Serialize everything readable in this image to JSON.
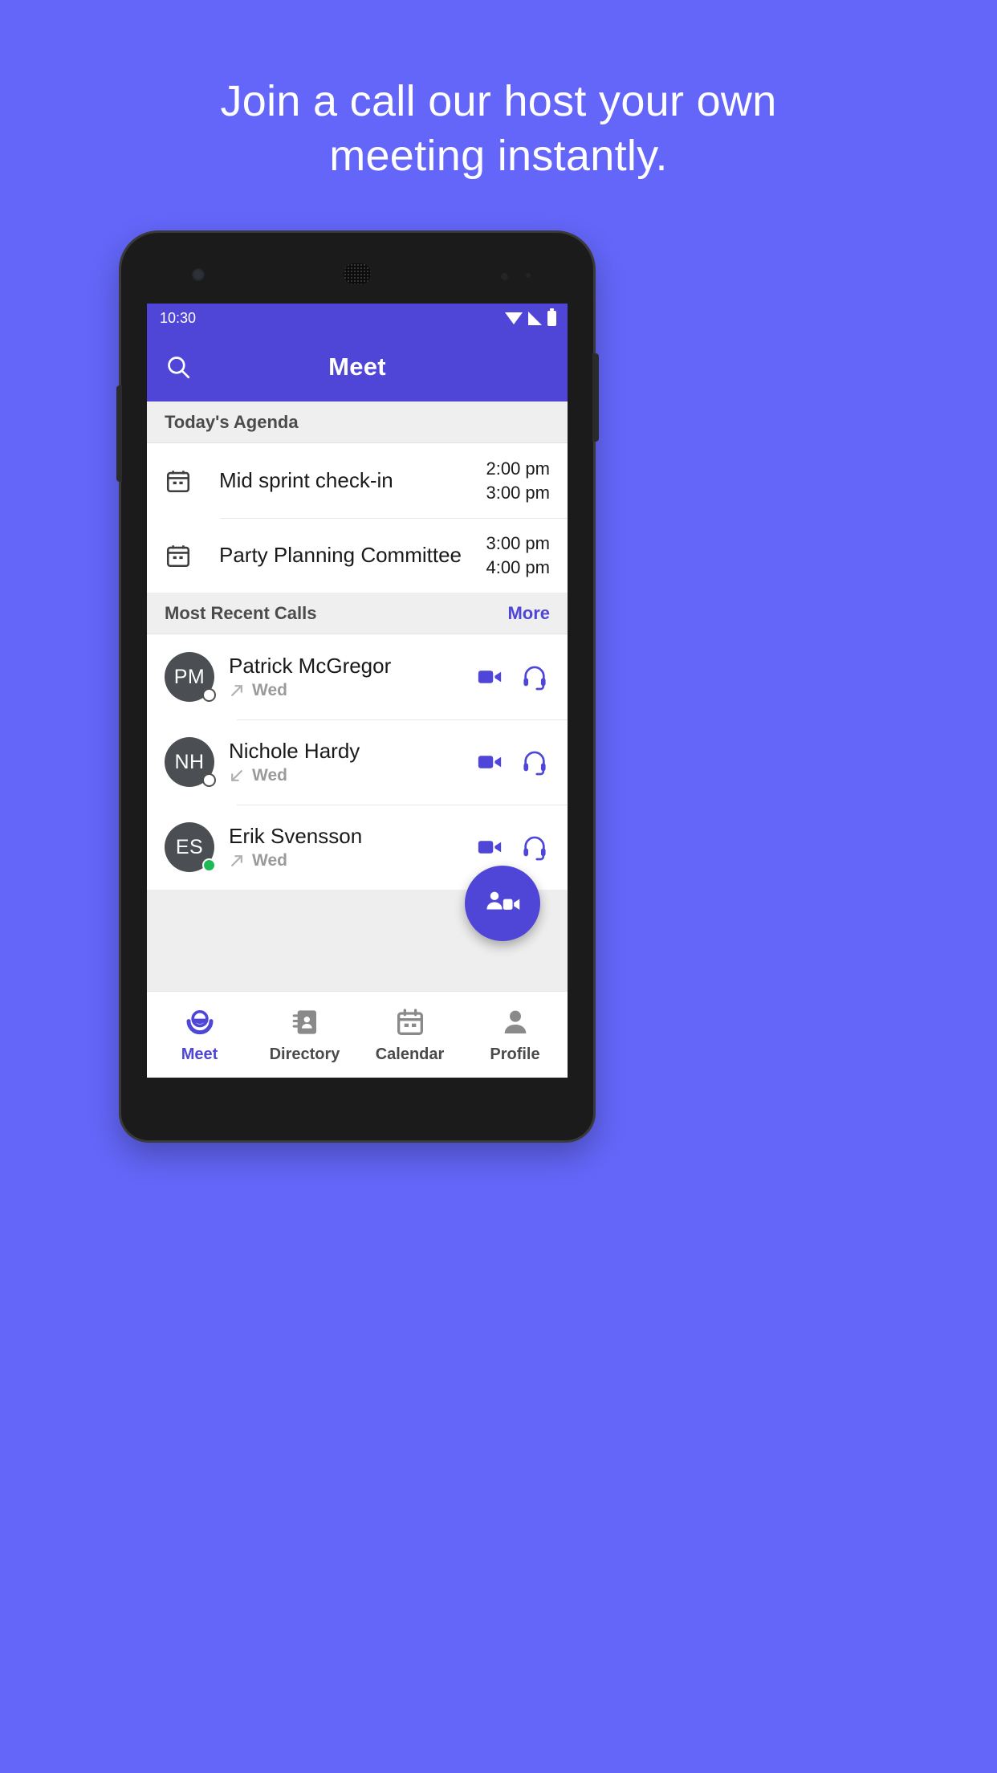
{
  "marketing": {
    "line1": "Join a call our host your own",
    "line2": "meeting instantly."
  },
  "colors": {
    "brand_purple": "#4f46d8",
    "page_background": "#6366f8",
    "avatar_grey": "#4b4f54",
    "online_green": "#1db954"
  },
  "statusbar": {
    "time": "10:30",
    "icons": [
      "wifi-icon",
      "signal-icon",
      "battery-icon"
    ]
  },
  "appbar": {
    "title": "Meet",
    "search_icon": "search-icon"
  },
  "agenda": {
    "section_title": "Today's Agenda",
    "items": [
      {
        "icon": "calendar-icon",
        "title": "Mid sprint check-in",
        "start_time": "2:00 pm",
        "end_time": "3:00 pm"
      },
      {
        "icon": "calendar-icon",
        "title": "Party Planning Committee",
        "start_time": "3:00 pm",
        "end_time": "4:00 pm"
      }
    ]
  },
  "recent_calls": {
    "section_title": "Most Recent Calls",
    "more_label": "More",
    "items": [
      {
        "initials": "PM",
        "name": "Patrick McGregor",
        "direction_icon": "arrow-outgoing-icon",
        "day": "Wed",
        "presence": "offline",
        "actions": [
          "video-call-icon",
          "audio-call-icon"
        ]
      },
      {
        "initials": "NH",
        "name": "Nichole Hardy",
        "direction_icon": "arrow-incoming-icon",
        "day": "Wed",
        "presence": "offline",
        "actions": [
          "video-call-icon",
          "audio-call-icon"
        ]
      },
      {
        "initials": "ES",
        "name": "Erik Svensson",
        "direction_icon": "arrow-outgoing-icon",
        "day": "Wed",
        "presence": "online",
        "actions": [
          "video-call-icon",
          "audio-call-icon"
        ]
      }
    ]
  },
  "fab": {
    "icon": "new-meeting-icon"
  },
  "bottom_nav": {
    "items": [
      {
        "label": "Meet",
        "icon": "meet-icon",
        "active": true
      },
      {
        "label": "Directory",
        "icon": "directory-icon",
        "active": false
      },
      {
        "label": "Calendar",
        "icon": "calendar-nav-icon",
        "active": false
      },
      {
        "label": "Profile",
        "icon": "profile-icon",
        "active": false
      }
    ]
  }
}
